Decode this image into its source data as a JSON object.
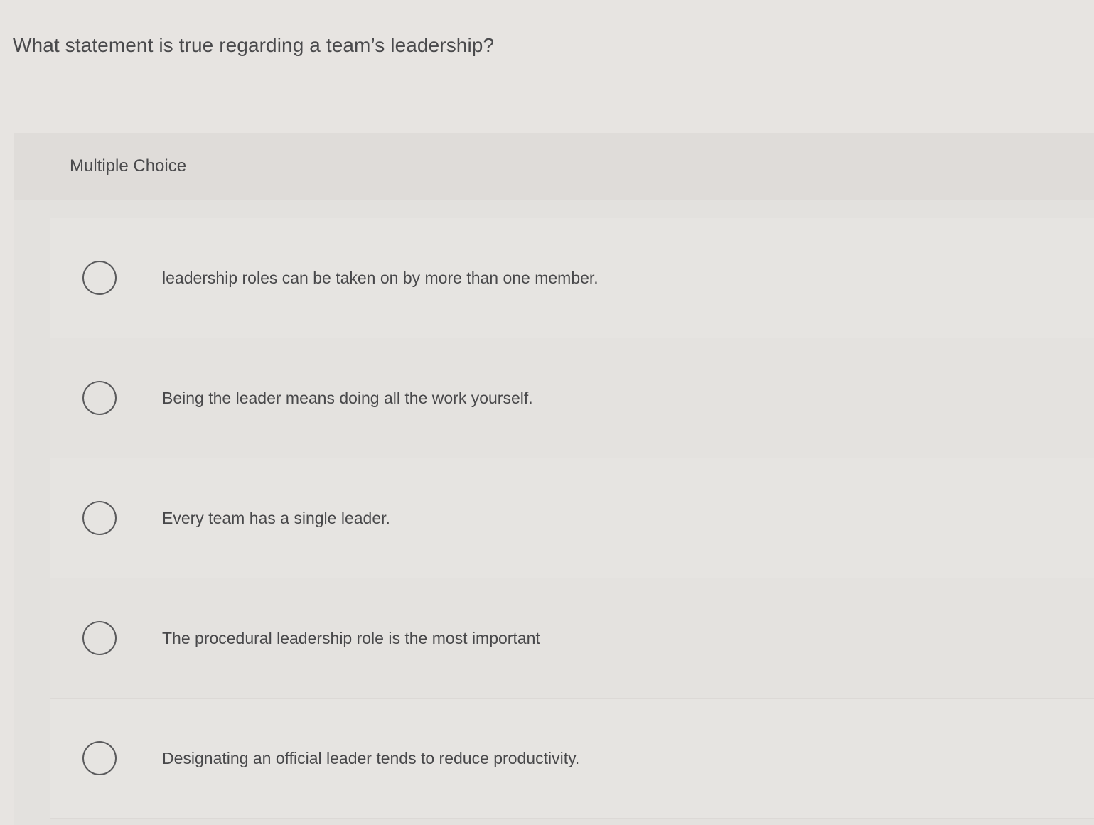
{
  "question": {
    "text": "What statement is true regarding a team’s leadership?"
  },
  "panel": {
    "type_label": "Multiple Choice",
    "options": [
      {
        "label": "leadership roles can be taken on by more than one member.",
        "selected": false
      },
      {
        "label": "Being the leader means doing all the work yourself.",
        "selected": false
      },
      {
        "label": "Every team has a single leader.",
        "selected": false
      },
      {
        "label": "The procedural leadership role is the most important",
        "selected": false
      },
      {
        "label": "Designating an official leader tends to reduce productivity.",
        "selected": false
      }
    ]
  }
}
